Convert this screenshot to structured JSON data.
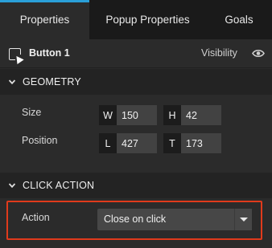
{
  "tabs": [
    {
      "label": "Properties",
      "active": true
    },
    {
      "label": "Popup Properties",
      "active": false
    },
    {
      "label": "Goals",
      "active": false
    }
  ],
  "element": {
    "name": "Button 1",
    "visibility_label": "Visibility",
    "icon": "button-element-icon"
  },
  "geometry": {
    "title": "GEOMETRY",
    "size_label": "Size",
    "position_label": "Position",
    "width": {
      "key": "W",
      "value": "150"
    },
    "height": {
      "key": "H",
      "value": "42"
    },
    "left": {
      "key": "L",
      "value": "427"
    },
    "top": {
      "key": "T",
      "value": "173"
    }
  },
  "click_action": {
    "title": "CLICK ACTION",
    "action_label": "Action",
    "selected": "Close on click"
  },
  "colors": {
    "accent": "#2a9fd8",
    "highlight": "#e03a1c",
    "panel": "#2b2b2b",
    "tabbar": "#1a1a1a"
  }
}
